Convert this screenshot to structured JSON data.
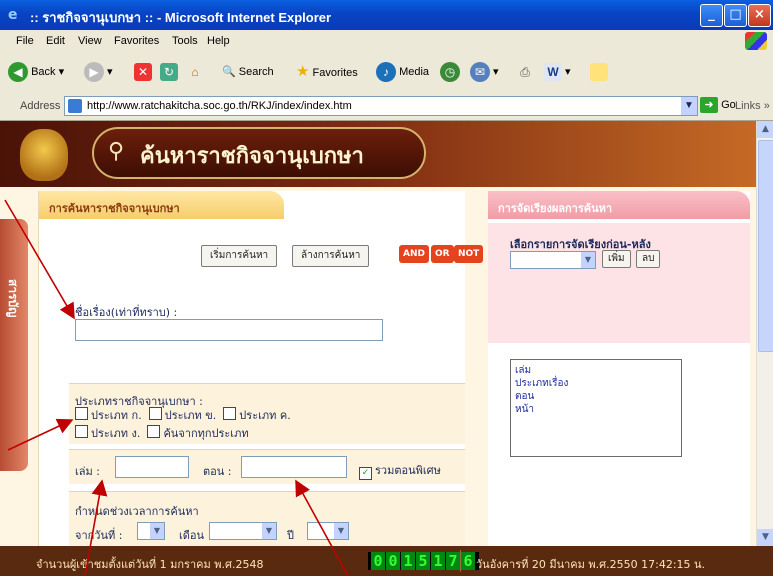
{
  "window": {
    "title": ":: ราชกิจจานุเบกษา :: - Microsoft Internet Explorer"
  },
  "menu": [
    "File",
    "Edit",
    "View",
    "Favorites",
    "Tools",
    "Help"
  ],
  "toolbar": {
    "back": "Back",
    "search": "Search",
    "favorites": "Favorites",
    "media": "Media",
    "links": "Links"
  },
  "address": {
    "label": "Address",
    "url": "http://www.ratchakitcha.soc.go.th/RKJ/index/index.htm",
    "go": "Go"
  },
  "header": {
    "logo_text": "ค้นหาราชกิจจานุเบกษา"
  },
  "sidetab": {
    "label": "สารบัญ"
  },
  "search_panel": {
    "tab_title": "การค้นหาราชกิจจานุเบกษา",
    "start_button": "เริ่มการค้นหา",
    "clear_button": "ล้างการค้นหา",
    "operators": [
      "AND",
      "OR",
      "NOT"
    ],
    "title_label": "ชื่อเรื่อง(เท่าที่ทราบ) :",
    "type_label": "ประเภทราชกิจจานุเบกษา :",
    "types": [
      "ประเภท ก.",
      "ประเภท ข.",
      "ประเภท ค.",
      "ประเภท ง.",
      "ค้นจากทุกประเภท"
    ],
    "volume_label": "เล่ม :",
    "issue_label": "ตอน :",
    "special_label": "รวมตอนพิเศษ",
    "period_label": "กำหนดช่วงเวลาการค้นหา",
    "from_date_label": "จากวันที่ :",
    "month_label": "เดือน",
    "year_label": "ปี"
  },
  "sort_panel": {
    "tab_title": "การจัดเรียงผลการค้นหา",
    "select_label": "เลือกรายการจัดเรียงก่อน-หลัง",
    "add_button": "เพิ่ม",
    "delete_button": "ลบ",
    "items": [
      "เล่ม",
      "ประเภทเรื่อง",
      "ตอน",
      "หน้า"
    ]
  },
  "status": {
    "visitors_text": "จำนวนผู้เข้าชมตั้งแต่วันที่ 1 มกราคม พ.ศ.2548",
    "counter": "0015176",
    "datetime": "วันอังคารที่ 20 มีนาคม พ.ศ.2550 17:42:15 น."
  },
  "colors": {
    "title_bar": "#0a4fd0",
    "header_brown": "#7a2811",
    "operator_red": "#e5431e",
    "annotation_arrow": "#c00000"
  }
}
